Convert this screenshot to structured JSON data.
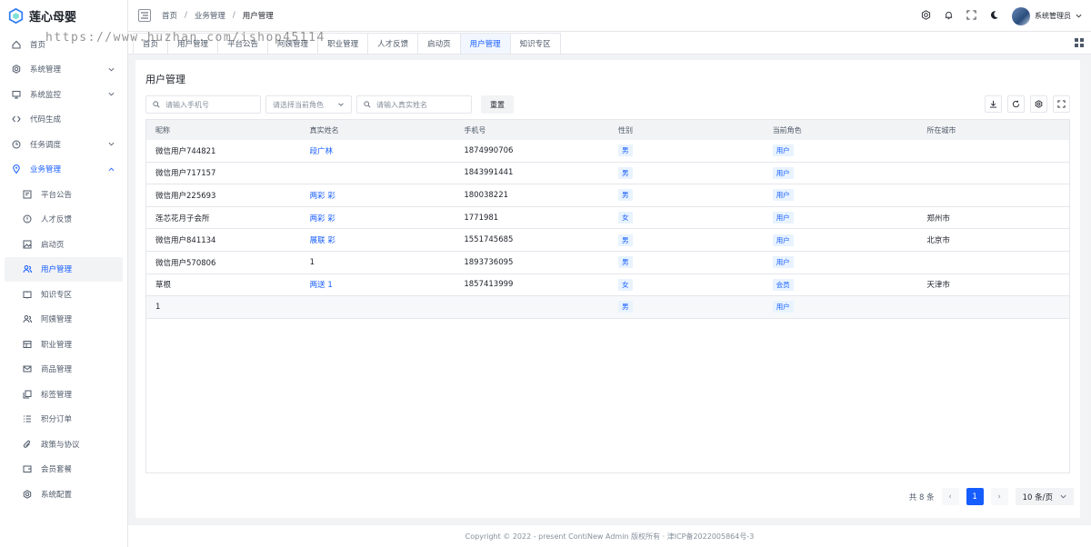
{
  "app": {
    "name": "莲心母婴"
  },
  "sidebar": {
    "items": [
      {
        "label": "首页",
        "icon": "home-icon"
      },
      {
        "label": "系统管理",
        "icon": "settings-icon",
        "chevron": "down"
      },
      {
        "label": "系统监控",
        "icon": "monitor-icon",
        "chevron": "down"
      },
      {
        "label": "代码生成",
        "icon": "code-icon"
      },
      {
        "label": "任务调度",
        "icon": "clock-icon",
        "chevron": "down"
      },
      {
        "label": "业务管理",
        "icon": "location-icon",
        "chevron": "up",
        "open": true
      },
      {
        "label": "平台公告",
        "icon": "notice-icon",
        "sub": true
      },
      {
        "label": "人才反馈",
        "icon": "info-icon",
        "sub": true
      },
      {
        "label": "启动页",
        "icon": "image-icon",
        "sub": true
      },
      {
        "label": "用户管理",
        "icon": "user-group-icon",
        "sub": true,
        "active": true
      },
      {
        "label": "知识专区",
        "icon": "book-icon",
        "sub": true
      },
      {
        "label": "阿姨管理",
        "icon": "user-group-icon",
        "sub": true
      },
      {
        "label": "职业管理",
        "icon": "nav-icon",
        "sub": true
      },
      {
        "label": "商品管理",
        "icon": "mail-icon",
        "sub": true
      },
      {
        "label": "标签管理",
        "icon": "copy-icon",
        "sub": true
      },
      {
        "label": "积分订单",
        "icon": "list-icon",
        "sub": true
      },
      {
        "label": "政策与协议",
        "icon": "attachment-icon",
        "sub": true
      },
      {
        "label": "会员套餐",
        "icon": "wallet-icon",
        "sub": true
      },
      {
        "label": "系统配置",
        "icon": "gear-icon",
        "sub": true
      }
    ]
  },
  "breadcrumb": {
    "items": [
      "首页",
      "业务管理",
      "用户管理"
    ],
    "sep": "/"
  },
  "header": {
    "user": "系统管理员"
  },
  "tabs": [
    "首页",
    "用户管理",
    "平台公告",
    "阿姨管理",
    "职业管理",
    "人才反馈",
    "启动页",
    "用户管理",
    "知识专区"
  ],
  "active_tab_index": 7,
  "watermark": "https://www.huzhan.com/ishop45114",
  "page": {
    "title": "用户管理",
    "filters": {
      "phone_placeholder": "请输入手机号",
      "role_placeholder": "请选择当前角色",
      "realname_placeholder": "请输入真实姓名",
      "reset_label": "重置"
    },
    "columns": [
      "昵称",
      "真实姓名",
      "手机号",
      "性别",
      "当前角色",
      "所在城市"
    ],
    "rows": [
      {
        "nickname": "微信用户744821",
        "realname": "段广林",
        "phone": "1874990706",
        "gender": "男",
        "role": "用户",
        "city": ""
      },
      {
        "nickname": "微信用户717157",
        "realname": "",
        "phone": "1843991441",
        "gender": "男",
        "role": "用户",
        "city": ""
      },
      {
        "nickname": "微信用户225693",
        "realname": "两彩 彩",
        "phone": "180038221",
        "gender": "男",
        "role": "用户",
        "city": ""
      },
      {
        "nickname": "莲芯花月子会所",
        "realname": "两彩 彩",
        "phone": "1771981",
        "gender": "女",
        "role": "用户",
        "city": "郑州市"
      },
      {
        "nickname": "微信用户841134",
        "realname": "展联 彩",
        "phone": "1551745685",
        "gender": "男",
        "role": "用户",
        "city": "北京市"
      },
      {
        "nickname": "微信用户570806",
        "realname": "1",
        "phone": "1893736095",
        "gender": "男",
        "role": "用户",
        "city": ""
      },
      {
        "nickname": "草根",
        "realname": "两送 1",
        "phone": "1857413999",
        "gender": "女",
        "role": "会员",
        "city": "天津市"
      },
      {
        "nickname": "1",
        "realname": "",
        "phone": "",
        "gender": "男",
        "role": "用户",
        "city": ""
      }
    ],
    "pagination": {
      "total_text": "共 8 条",
      "current": "1",
      "page_size": "10 条/页",
      "prev": "‹",
      "next": "›"
    }
  },
  "footer": {
    "text": "Copyright © 2022 - present ContiNew Admin 版权所有 · 津ICP备2022005864号-3"
  },
  "colors": {
    "accent": "#165dff",
    "tag_bg": "#e8f3ff",
    "bg": "#f2f3f5"
  }
}
